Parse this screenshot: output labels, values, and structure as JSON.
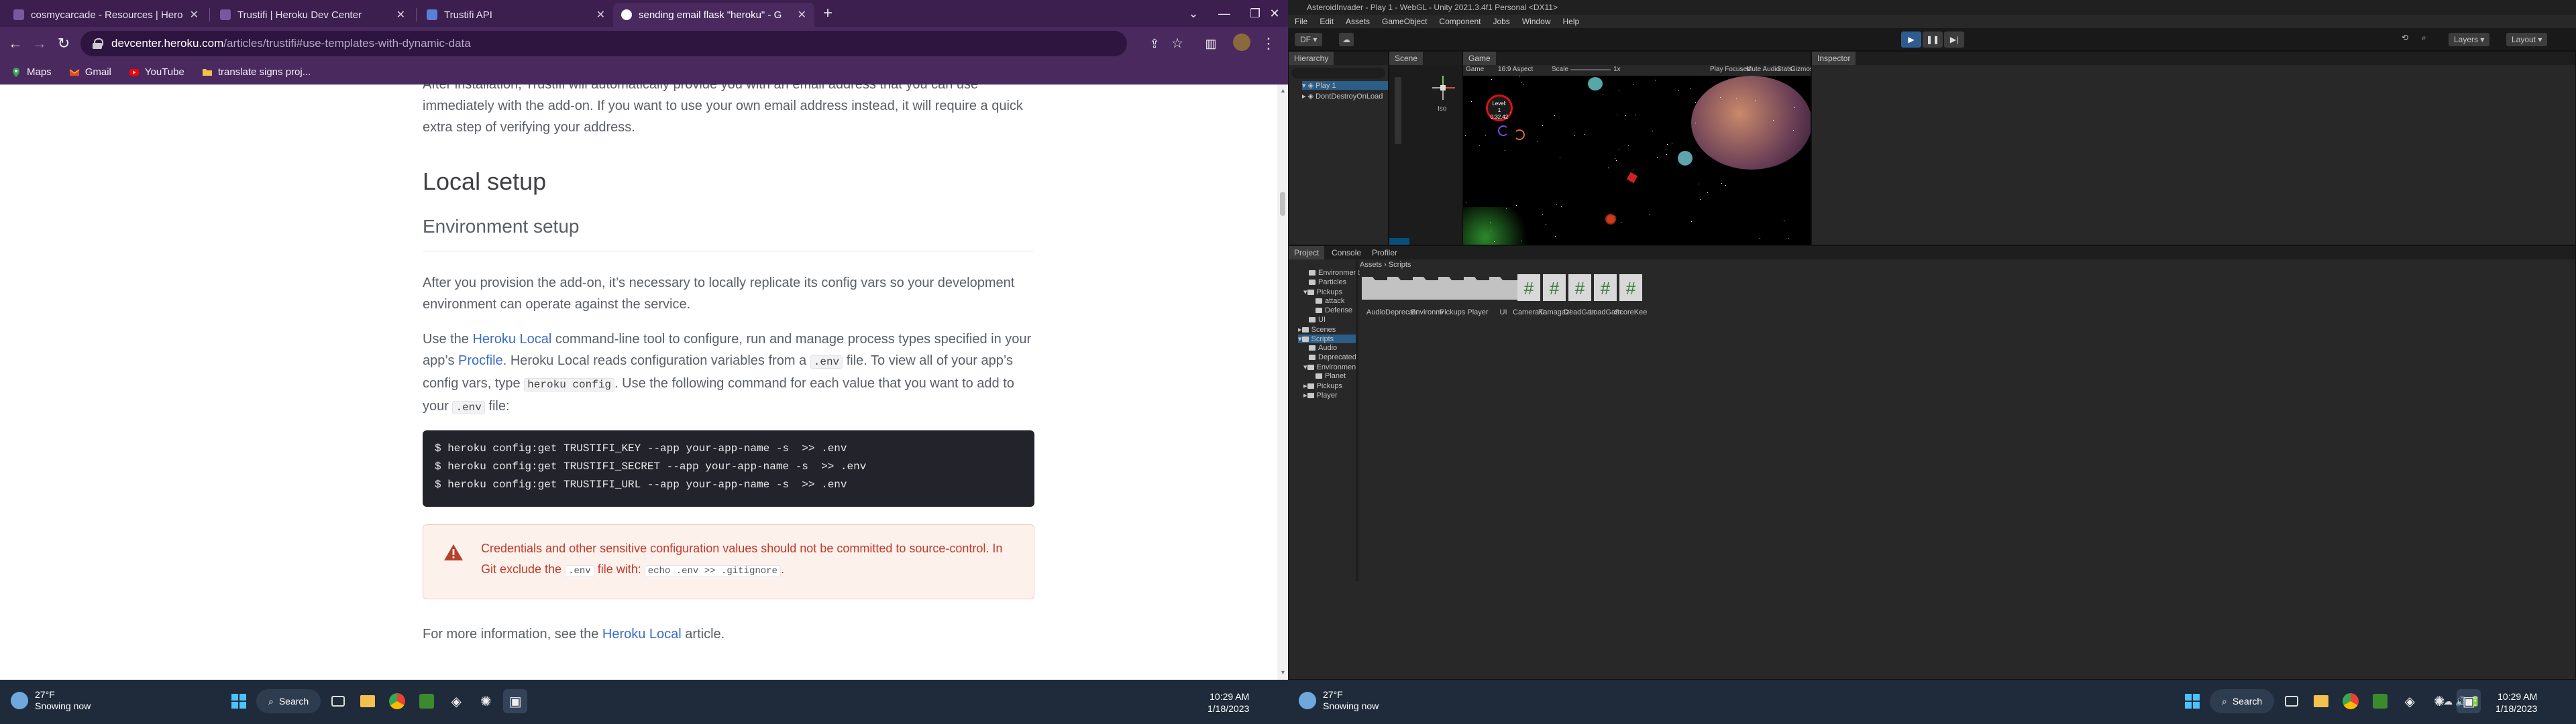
{
  "browser": {
    "tabs": [
      {
        "title": "cosmycarcade - Resources | Hero",
        "active": false
      },
      {
        "title": "Trustifi | Heroku Dev Center",
        "active": false
      },
      {
        "title": "Trustifi API",
        "active": false
      },
      {
        "title": "sending email flask \"heroku\" - G",
        "active": true
      }
    ],
    "url_host": "devcenter.heroku.com",
    "url_path": "/articles/trustifi#use-templates-with-dynamic-data",
    "bookmarks": [
      "Maps",
      "Gmail",
      "YouTube",
      "translate signs proj..."
    ]
  },
  "article": {
    "intro": "After installation, Trustifi will automatically provide you with an email address that you can use immediately with the add-on. If you want to use your own email address instead, it will require a quick extra step of verifying your address.",
    "h2": "Local setup",
    "h3": "Environment setup",
    "p1": "After you provision the add-on, it’s necessary to locally replicate its config vars so your development environment can operate against the service.",
    "p2": {
      "t1": "Use the ",
      "link1": "Heroku Local",
      "t2": " command-line tool to configure, run and manage process types specified in your app’s ",
      "link2": "Procfile",
      "t3": ". Heroku Local reads configuration variables from a ",
      "code1": ".env",
      "t4": " file. To view all of your app’s config vars, type ",
      "code2": "heroku config",
      "t5": ". Use the following command for each value that you want to add to your ",
      "code3": ".env",
      "t6": " file:"
    },
    "code_lines": [
      "$ heroku config:get TRUSTIFI_KEY --app your-app-name -s  >> .env",
      "$ heroku config:get TRUSTIFI_SECRET --app your-app-name -s  >> .env",
      "$ heroku config:get TRUSTIFI_URL --app your-app-name -s  >> .env"
    ],
    "warning": {
      "t1": "Credentials and other sensitive configuration values should not be committed to source-control. In Git exclude the ",
      "code1": ".env",
      "t2": " file with: ",
      "code2": "echo .env >> .gitignore",
      "t3": "."
    },
    "more": {
      "t1": "For more information, see the ",
      "link": "Heroku Local",
      "t2": " article."
    }
  },
  "taskbar_left": {
    "weather_temp": "27°F",
    "weather_desc": "Snowing now",
    "search": "Search",
    "time": "10:29 AM",
    "date": "1/18/2023"
  },
  "taskbar_right": {
    "weather_temp": "27°F",
    "weather_desc": "Snowing now",
    "search": "Search",
    "time": "10:29 AM",
    "date": "1/18/2023"
  },
  "unity": {
    "title": "AsteroidInvader - Play 1 - WebGL - Unity 2021.3.4f1 Personal <DX11>",
    "menu": [
      "File",
      "Edit",
      "Assets",
      "GameObject",
      "Component",
      "Jobs",
      "Window",
      "Help"
    ],
    "account": "DF",
    "right_toolbar": [
      "Layers",
      "Layout"
    ],
    "panels": {
      "hierarchy": "Hierarchy",
      "scene": "Scene",
      "game": "Game",
      "inspector": "Inspector",
      "project": "Project",
      "console": "Console",
      "profiler": "Profiler"
    },
    "hierarchy_items": [
      "Play 1",
      "DontDestroyOnLoad"
    ],
    "game_bar": {
      "display": "Game",
      "aspect": "16:9 Aspect",
      "scale_label": "Scale",
      "scale_value": "1x",
      "play_focused": "Play Focused",
      "mute": "Mute Audio",
      "stats": "Stats",
      "gizmos": "Gizmos"
    },
    "scene_persp": "Iso",
    "hud": {
      "level_label": "Level:",
      "level": "1",
      "timer": "0:32.42"
    },
    "breadcrumb": [
      "Assets",
      "Scripts"
    ],
    "project_tree": [
      "Environment",
      "Particles",
      "Pickups",
      "attack",
      "Defense",
      "UI",
      "Scenes",
      "Scripts",
      "Audio",
      "Deprecated",
      "Environment",
      "Planet",
      "Pickups",
      "Player"
    ],
    "assets": [
      {
        "name": "Audio",
        "kind": "folder"
      },
      {
        "name": "Deprecated",
        "kind": "folder"
      },
      {
        "name": "Environme...",
        "kind": "folder"
      },
      {
        "name": "Pickups",
        "kind": "folder"
      },
      {
        "name": "Player",
        "kind": "folder"
      },
      {
        "name": "UI",
        "kind": "folder"
      },
      {
        "name": "CameraTa...",
        "kind": "script"
      },
      {
        "name": "Kamagazi...",
        "kind": "script"
      },
      {
        "name": "DeadGame...",
        "kind": "script"
      },
      {
        "name": "LoadGame",
        "kind": "script"
      },
      {
        "name": "ScoreKee...",
        "kind": "script"
      }
    ],
    "colors": {
      "play_blue": "#2f5c8e",
      "script_green": "#3a7a3a"
    }
  }
}
